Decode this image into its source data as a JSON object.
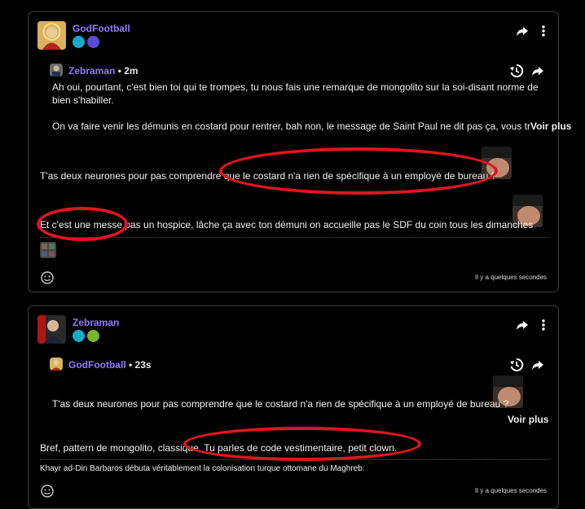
{
  "posts": [
    {
      "author": "GodFootball",
      "quote": {
        "author": "Zebraman",
        "time": "2m",
        "line1": "Ah oui, pourtant, c'est bien toi qui te trompes, tu nous fais une remarque de mongolito sur la soi-disant norme de bien s'habiller.",
        "line2": "On va faire venir les démunis en costard pour rentrer, bah non, le message de Saint Paul ne dit pas ça, vous tr",
        "see_more": "Voir plus"
      },
      "reply1": "T'as deux neurones pour pas comprendre que le costard n'a rien de spécifique à un employé de bureau ?",
      "reply2": "Et c'est une messe pas un hospice, lâche ça avec ton démuni on accueille pas le SDF du coin tous les dimanches",
      "timestamp": "Il y a quelques secondes"
    },
    {
      "author": "Zebraman",
      "quote": {
        "author": "GodFootball",
        "time": "23s",
        "line1": "T'as deux neurones pour pas comprendre que le costard n'a rien de spécifique à un employé de bureau ?",
        "see_more": "Voir plus"
      },
      "reply1": "Bref, pattern de mongolito, classique. Tu parles de code vestimentaire, petit clown.",
      "signature": "Khayr ad-Din Barbaros débuta véritablement la colonisation turque ottomane du Maghreb.",
      "timestamp": "Il y a quelques secondes"
    }
  ],
  "colors": {
    "username": "#8f7bff",
    "annotation": "#e0141f",
    "border": "#3a3a3a"
  },
  "icons": [
    "share-icon",
    "more-vertical-icon",
    "history-icon",
    "emoji-react-icon"
  ]
}
